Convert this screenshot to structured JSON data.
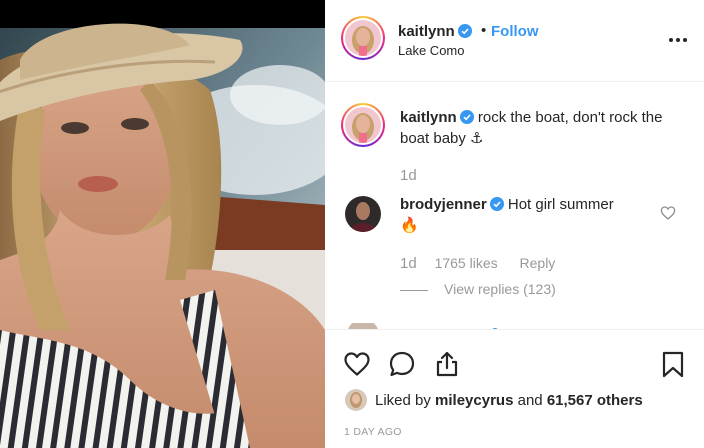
{
  "post": {
    "username": "kaitlynn",
    "follow_label": "Follow",
    "location": "Lake Como",
    "dot": "•"
  },
  "caption": {
    "username": "kaitlynn",
    "text": "rock the boat, don't rock the boat baby ⚓",
    "time": "1d"
  },
  "comment": {
    "username": "brodyjenner",
    "text": "Hot girl summer",
    "emoji": "🔥",
    "time": "1d",
    "likes": "1765 likes",
    "reply_label": "Reply",
    "view_replies": "View replies (123)"
  },
  "likes": {
    "prefix": "Liked by",
    "user": "mileycyrus",
    "conj": "and",
    "others": "61,567 others"
  },
  "timestamp": "1 DAY AGO",
  "colors": {
    "accent": "#3897f0",
    "text": "#262626",
    "muted": "#999999",
    "border": "#efefef"
  },
  "icons": [
    "verified-badge-icon",
    "more-options-icon",
    "heart-icon",
    "comment-icon",
    "share-icon",
    "bookmark-icon"
  ]
}
